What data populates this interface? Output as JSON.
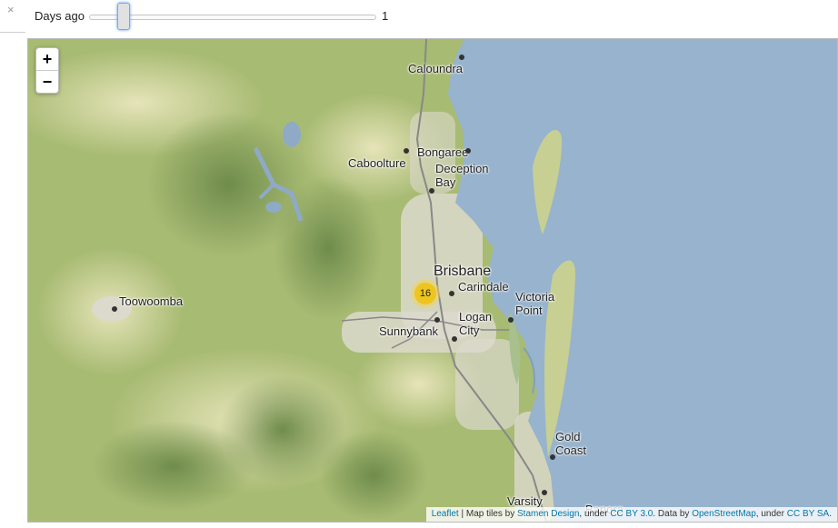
{
  "toolbar": {
    "close_glyph": "×",
    "slider_label": "Days ago",
    "slider_value": "1",
    "slider_fraction": 0.12
  },
  "map": {
    "zoom_in": "+",
    "zoom_out": "−",
    "places": {
      "caloundra": "Caloundra",
      "bongaree": "Bongaree",
      "caboolture": "Caboolture",
      "deception_line1": "Deception",
      "deception_line2": "Bay",
      "brisbane": "Brisbane",
      "carindale": "Carindale",
      "toowoomba": "Toowoomba",
      "victoria_line1": "Victoria",
      "victoria_line2": "Point",
      "logan_line1": "Logan",
      "logan_line2": "City",
      "sunnybank": "Sunnybank",
      "gold_line1": "Gold",
      "gold_line2": "Coast",
      "varsity": "Varsity",
      "banora": "Banora"
    },
    "cluster_count": "16",
    "colors": {
      "water": "#97b3cd",
      "land": "#a8bb73",
      "cluster": "#f0c20c"
    }
  },
  "attribution": {
    "leaflet": "Leaflet",
    "sep1": " | Map tiles by ",
    "stamen": "Stamen Design",
    "sep2": ", under ",
    "cc_by": "CC BY 3.0",
    "sep3": ". Data by ",
    "osm": "OpenStreetMap",
    "sep4": ", under ",
    "cc_by_sa": "CC BY SA",
    "end": "."
  }
}
